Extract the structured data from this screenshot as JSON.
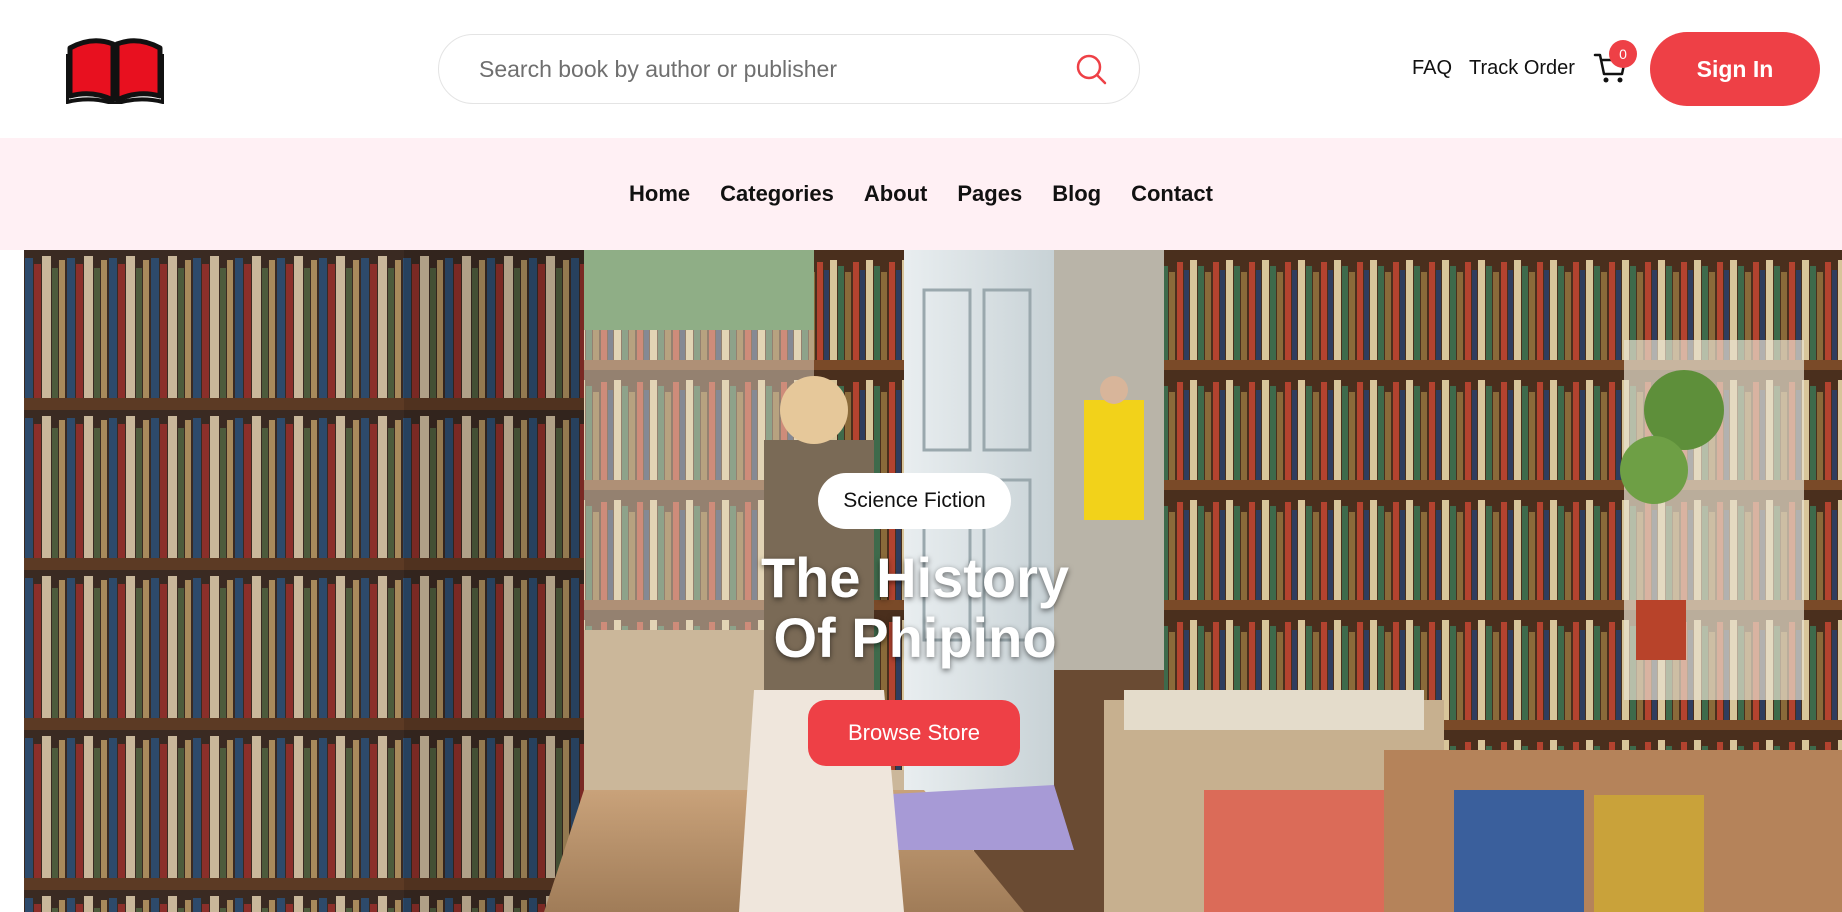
{
  "brand": {
    "logo_icon": "open-book-icon",
    "accent": "#ee4046",
    "logo_color": "#e8101f"
  },
  "search": {
    "placeholder": "Search book by author or publisher",
    "icon": "search-icon"
  },
  "utility": {
    "faq": "FAQ",
    "track_order": "Track Order",
    "cart_icon": "cart-icon",
    "cart_count": "0",
    "sign_in": "Sign In"
  },
  "nav": {
    "items": [
      "Home",
      "Categories",
      "About",
      "Pages",
      "Blog",
      "Contact"
    ],
    "background": "#fff0f4"
  },
  "hero": {
    "image": "bookstore-interior-photo",
    "tag": "Science Fiction",
    "title_line1": "The History",
    "title_line2": "Of Phipino",
    "button": "Browse Store"
  }
}
